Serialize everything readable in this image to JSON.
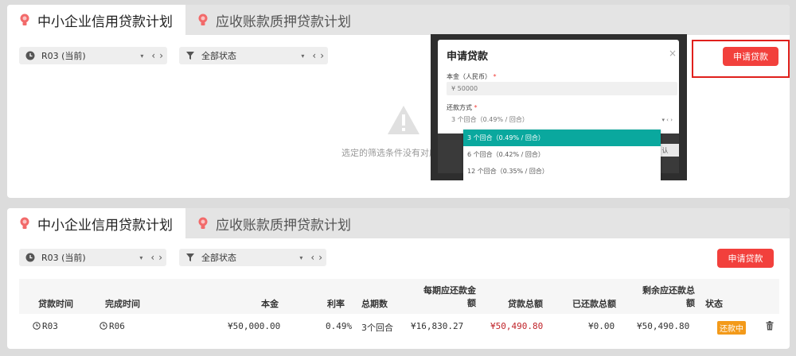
{
  "tabs": {
    "credit_loan": "中小企业信用贷款计划",
    "receivable_loan": "应收账款质押贷款计划"
  },
  "filters": {
    "round_value": "R03 (当前)",
    "status_value": "全部状态"
  },
  "buttons": {
    "apply_loan": "申请贷款"
  },
  "empty_state": {
    "message": "选定的筛选条件没有对应"
  },
  "modal": {
    "title": "申请贷款",
    "close": "×",
    "principal_label": "本金（人民币）",
    "required_mark": "*",
    "principal_value": "¥ 50000",
    "repayment_label": "还款方式",
    "repayment_value": "3 个回合（0.49% / 回合）",
    "dropdown_options": [
      "3 个回合（0.49% / 回合）",
      "6 个回合（0.42% / 回合）",
      "12 个回合（0.35% / 回合）"
    ],
    "confirm_partial": "认"
  },
  "table": {
    "headers": {
      "loan_time": "贷款时间",
      "finish_time": "完成时间",
      "principal": "本金",
      "rate": "利率",
      "periods": "总期数",
      "per_period_line1": "每期应还款金",
      "per_period_line2": "额",
      "loan_total": "贷款总额",
      "repaid_total": "已还款总额",
      "remaining_line1": "剩余应还款总",
      "remaining_line2": "额",
      "status": "状态"
    },
    "rows": [
      {
        "loan_time": "R03",
        "finish_time": "R06",
        "principal": "¥50,000.00",
        "rate": "0.49%",
        "periods": "3个回合",
        "per_period": "¥16,830.27",
        "loan_total": "¥50,490.80",
        "repaid_total": "¥0.00",
        "remaining": "¥50,490.80",
        "status": "还款中"
      }
    ]
  },
  "colors": {
    "accent_red": "#f2403c",
    "highlight_border": "#e0201c",
    "teal_selected": "#0aa89e",
    "status_orange": "#f39a1a",
    "amount_red": "#c0242a"
  },
  "icons": [
    "bulb-icon",
    "clock-icon",
    "filter-icon",
    "warning-icon",
    "trash-icon",
    "close-icon"
  ]
}
